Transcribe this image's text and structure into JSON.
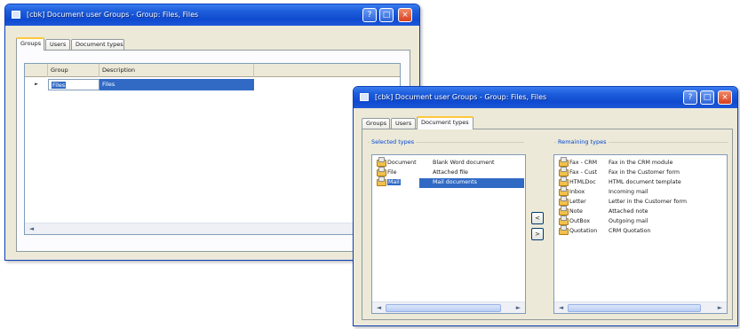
{
  "back_window": {
    "title": "[cbk] Document user Groups - Group: Files, Files",
    "tabs": [
      "Groups",
      "Users",
      "Document types"
    ],
    "active_tab": 0,
    "grid": {
      "columns": [
        "Group",
        "Description"
      ],
      "rows": [
        {
          "indicator": "►",
          "group": "Files",
          "description": "Files"
        }
      ]
    },
    "scroll_left": "◄"
  },
  "front_window": {
    "title": "[cbk] Document user Groups - Group: Files, Files",
    "tabs": [
      "Groups",
      "Users",
      "Document types"
    ],
    "active_tab": 2,
    "selected_label": "Selected types",
    "remaining_label": "Remaining types",
    "selected_types": [
      {
        "name": "Document",
        "description": "Blank Word document"
      },
      {
        "name": "File",
        "description": "Attached file"
      },
      {
        "name": "Mail",
        "description": "Mail documents"
      }
    ],
    "selected_index": 2,
    "remaining_types": [
      {
        "name": "Fax - CRM",
        "description": "Fax in the CRM module"
      },
      {
        "name": "Fax - Cust",
        "description": "Fax in the Customer form"
      },
      {
        "name": "HTMLDoc",
        "description": "HTML document template"
      },
      {
        "name": "Inbox",
        "description": "Incoming mail"
      },
      {
        "name": "Letter",
        "description": "Letter in the Customer form"
      },
      {
        "name": "Note",
        "description": "Attached note"
      },
      {
        "name": "OutBox",
        "description": "Outgoing mail"
      },
      {
        "name": "Quotation",
        "description": "CRM Quotation"
      }
    ],
    "move_left": "<",
    "move_right": ">",
    "scroll_left": "◄",
    "scroll_right": "►"
  },
  "title_buttons": {
    "help": "?",
    "maximize": "□",
    "close": "×"
  },
  "colors": {
    "titlebar": "#1e5fdc",
    "selection": "#316ac5",
    "window_bg": "#ece9d8",
    "active_tab_accent": "#ffc83c"
  }
}
